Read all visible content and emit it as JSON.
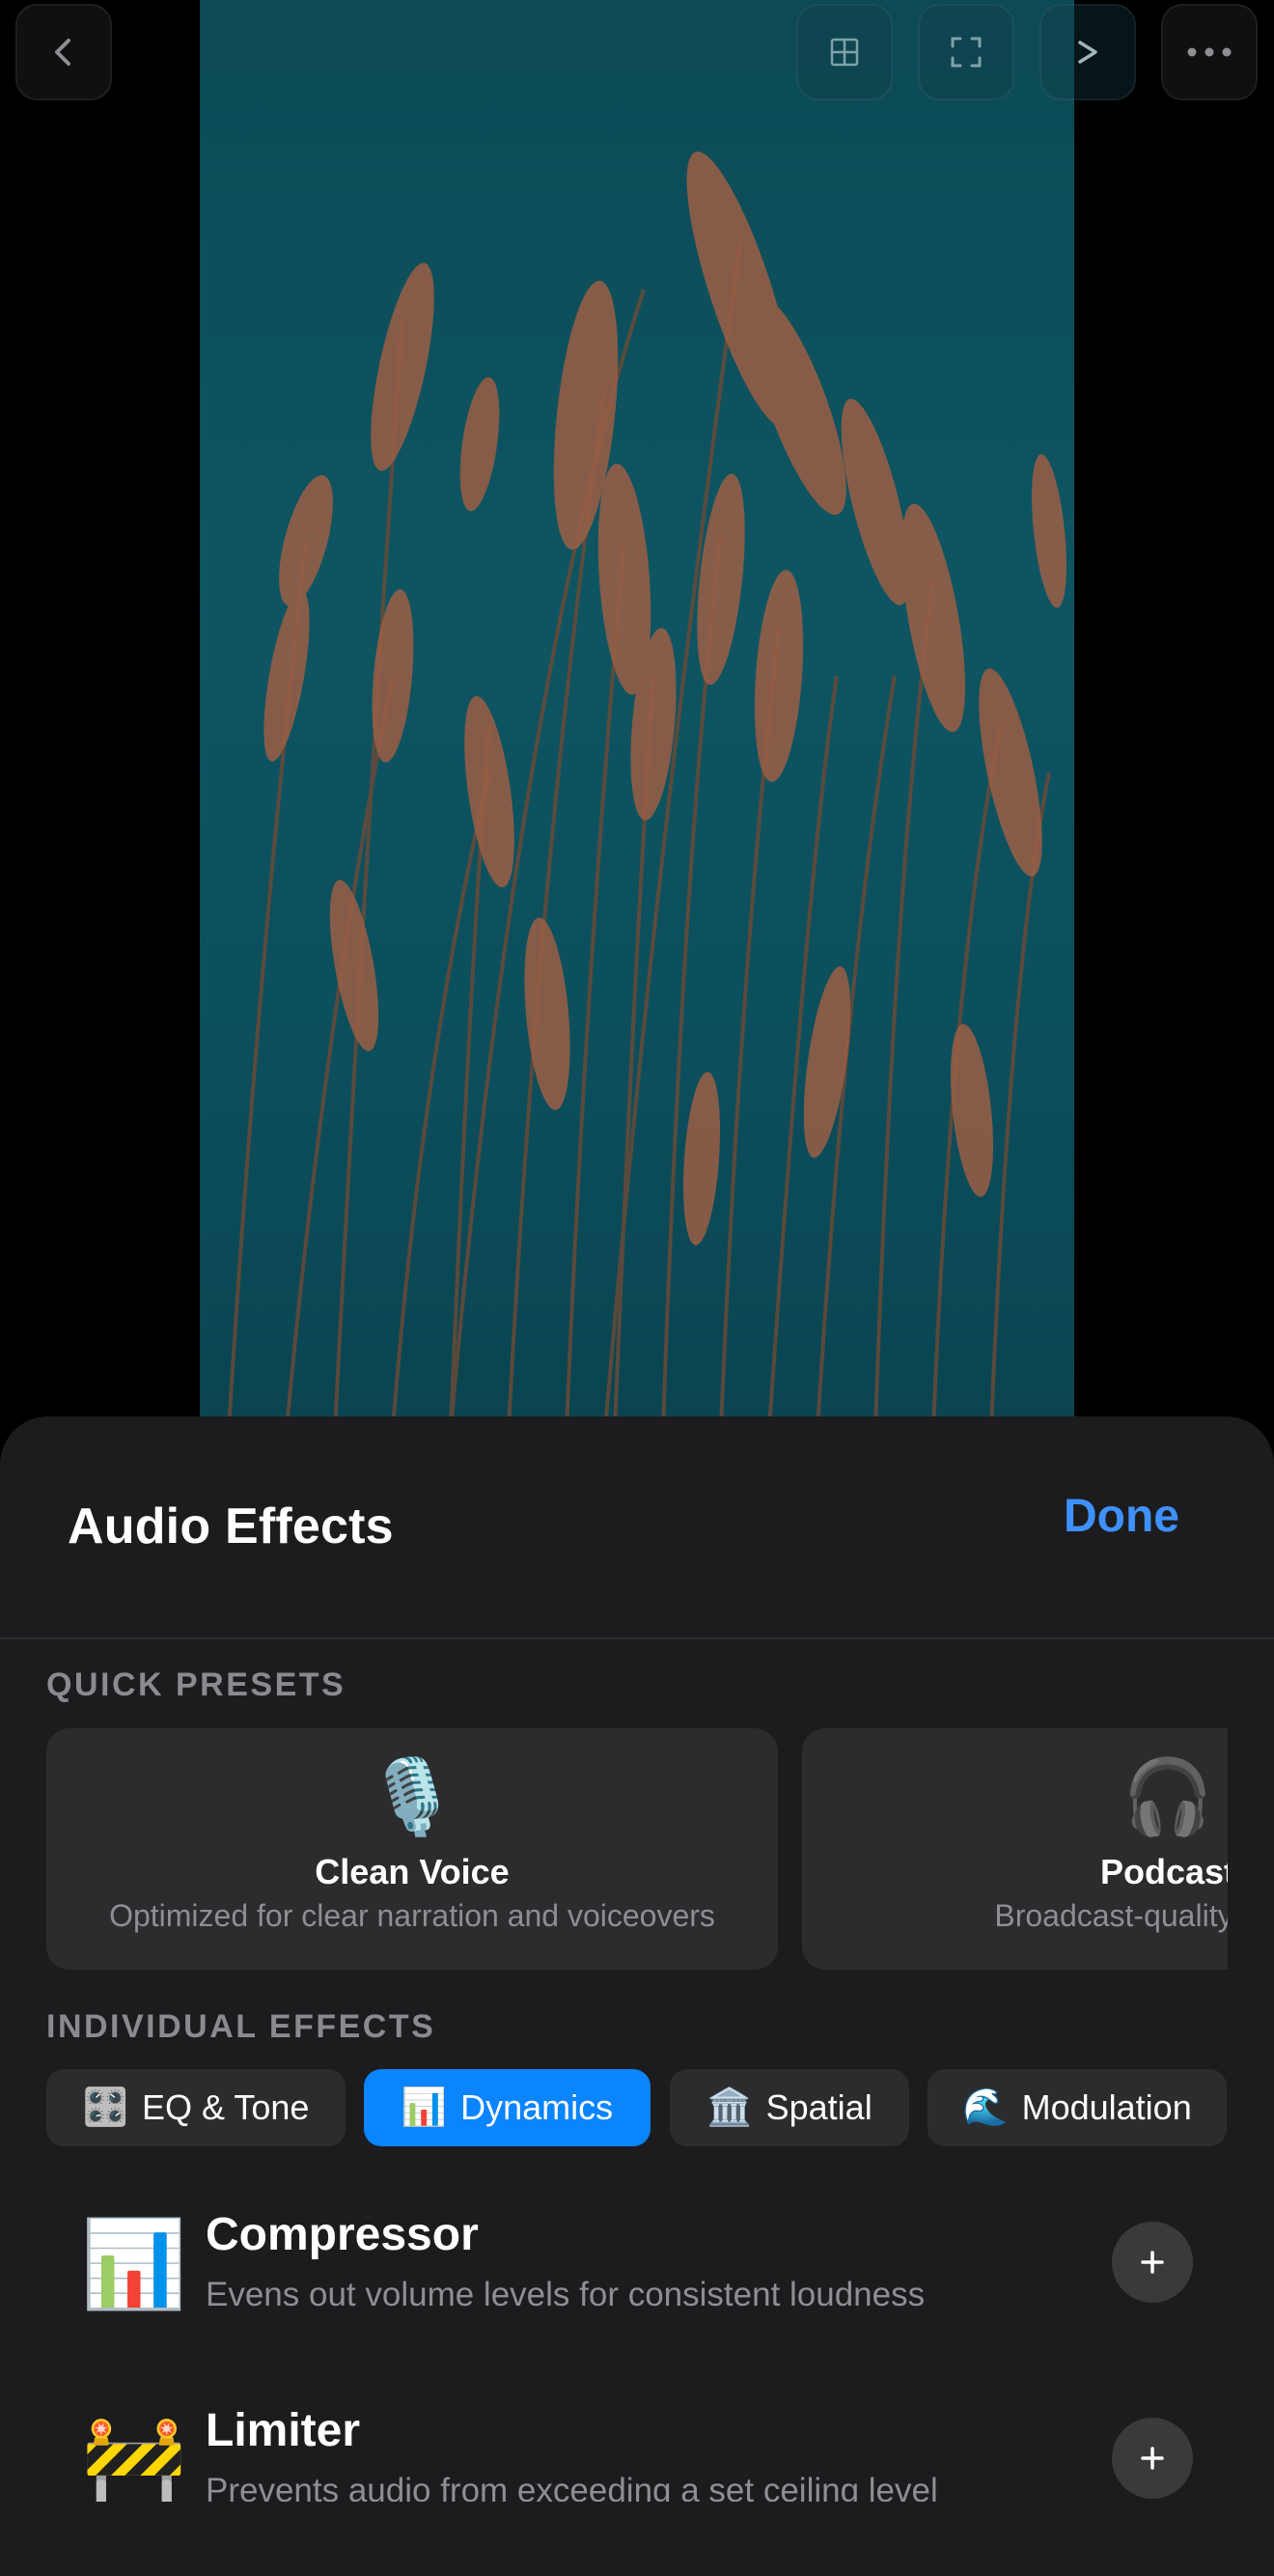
{
  "top_bar": {
    "back_icon": "chevron-left-icon",
    "grid_icon": "grid-icon",
    "fullscreen_icon": "fullscreen-icon",
    "next_icon": "chevron-right-icon",
    "more_icon": "more-dots-icon"
  },
  "sheet": {
    "title": "Audio Effects",
    "done_label": "Done",
    "quick_presets_label": "QUICK PRESETS",
    "individual_effects_label": "INDIVIDUAL EFFECTS"
  },
  "presets": [
    {
      "emoji": "🎙️",
      "name": "Clean Voice",
      "description": "Optimized for clear narration and voiceovers"
    },
    {
      "emoji": "🎧",
      "name": "Podcast",
      "description": "Broadcast-quality speech"
    }
  ],
  "tabs": [
    {
      "emoji": "🎛️",
      "label": "EQ & Tone",
      "active": false
    },
    {
      "emoji": "📊",
      "label": "Dynamics",
      "active": true
    },
    {
      "emoji": "🏛️",
      "label": "Spatial",
      "active": false
    },
    {
      "emoji": "🌊",
      "label": "Modulation",
      "active": false
    }
  ],
  "effects": [
    {
      "emoji": "📊",
      "name": "Compressor",
      "description": "Evens out volume levels for consistent loudness"
    },
    {
      "emoji": "🚧",
      "name": "Limiter",
      "description": "Prevents audio from exceeding a set ceiling level"
    }
  ],
  "colors": {
    "accent": "#0a84ff",
    "done": "#3f91ff",
    "sheet": "#1c1c1e",
    "card": "#2c2c2e"
  }
}
